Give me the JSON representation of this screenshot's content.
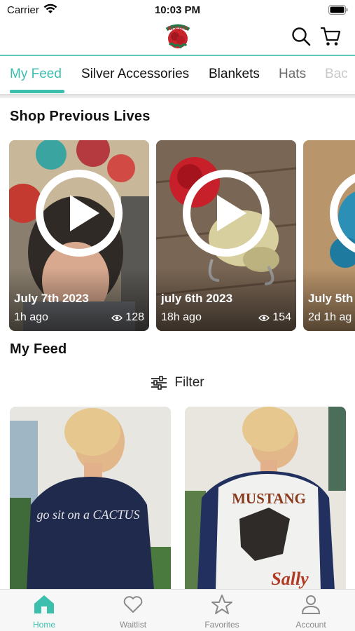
{
  "status_bar": {
    "carrier": "Carrier",
    "time": "10:03 PM"
  },
  "header": {
    "logo_text": "RODEO"
  },
  "tabs": [
    "My Feed",
    "Silver Accessories",
    "Blankets",
    "Hats",
    "Bac"
  ],
  "sections": {
    "lives_title": "Shop Previous Lives",
    "feed_title": "My Feed"
  },
  "lives": [
    {
      "date": "July 7th 2023",
      "ago": "1h ago",
      "views": "128"
    },
    {
      "date": "july 6th 2023",
      "ago": "18h ago",
      "views": "154"
    },
    {
      "date": "July 5th",
      "ago": "2d 1h ag",
      "views": ""
    }
  ],
  "filter": {
    "label": "Filter"
  },
  "products": [
    {
      "shirt_text": "go sit on a CACTUS"
    },
    {
      "shirt_text_top": "MUSTANG",
      "shirt_text_bottom": "Sally"
    }
  ],
  "nav": [
    {
      "label": "Home",
      "icon": "home-icon",
      "active": true
    },
    {
      "label": "Waitlist",
      "icon": "heart-icon",
      "active": false
    },
    {
      "label": "Favorites",
      "icon": "star-icon",
      "active": false
    },
    {
      "label": "Account",
      "icon": "person-icon",
      "active": false
    }
  ],
  "colors": {
    "accent": "#3dbfae",
    "header_line": "#5fc9b8",
    "inactive": "#8a8a8a"
  }
}
